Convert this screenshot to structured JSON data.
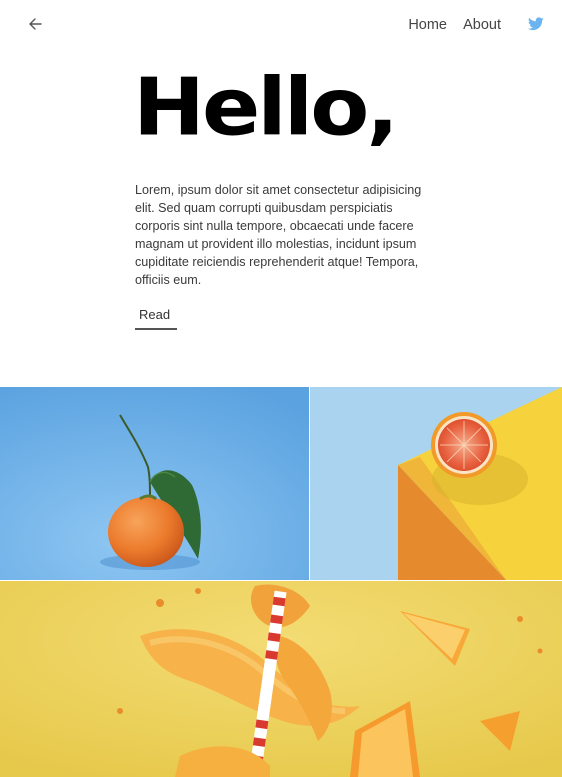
{
  "header": {
    "back_icon": "arrow-left-icon",
    "nav": [
      {
        "label": "Home"
      },
      {
        "label": "About"
      }
    ],
    "social_icon": "twitter-icon",
    "twitter_color": "#6cb4ef"
  },
  "hero": {
    "title": "Hello,",
    "body": "Lorem, ipsum dolor sit amet consectetur adipisicing elit. Sed quam corrupti quibusdam perspiciatis corporis sint nulla tempore, obcaecati unde facere magnam ut provident illo molestias, incidunt ipsum cupiditate reiciendis reprehenderit atque! Tempora, officiis eum.",
    "read_label": "Read"
  },
  "gallery": [
    {
      "subject": "tangerine with leaves on blue background",
      "background": "#6fb0e8"
    },
    {
      "subject": "halved grapefruit on yellow and orange blocks",
      "background": "#a9d3ef"
    },
    {
      "subject": "orange peels and slices with striped straw on yellow",
      "background": "#ebcf55"
    }
  ]
}
